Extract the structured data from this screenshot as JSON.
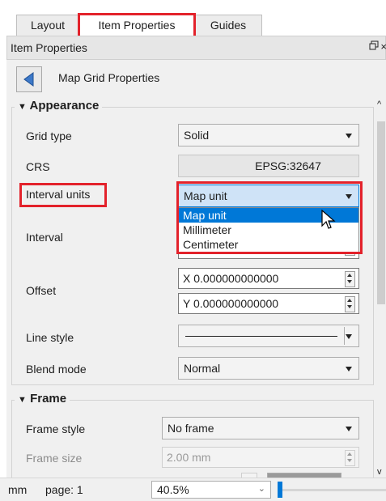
{
  "tabs": [
    {
      "label": "Layout"
    },
    {
      "label": "Item Properties"
    },
    {
      "label": "Guides"
    }
  ],
  "panel": {
    "title": "Item Properties",
    "float_icon": "float-icon",
    "close_glyph": "×"
  },
  "props_header": {
    "back_icon": "back-arrow-icon",
    "title": "Map Grid Properties"
  },
  "appearance": {
    "title": "Appearance",
    "grid_type": {
      "label": "Grid type",
      "value": "Solid"
    },
    "crs": {
      "label": "CRS",
      "value": "EPSG:32647"
    },
    "interval_units": {
      "label": "Interval units",
      "value": "Map unit",
      "options": [
        "Map unit",
        "Millimeter",
        "Centimeter"
      ]
    },
    "interval": {
      "label": "Interval"
    },
    "offset": {
      "label": "Offset",
      "x": "X 0.000000000000",
      "y": "Y 0.000000000000"
    },
    "line_style": {
      "label": "Line style"
    },
    "blend_mode": {
      "label": "Blend mode",
      "value": "Normal"
    }
  },
  "frame": {
    "title": "Frame",
    "frame_style": {
      "label": "Frame style",
      "value": "No frame"
    },
    "frame_size": {
      "label": "Frame size",
      "value": "2.00 mm"
    }
  },
  "status": {
    "units": "mm",
    "page": "page: 1",
    "zoom": "40.5%"
  },
  "colors": {
    "highlight": "#e3222b",
    "selection": "#0078d7",
    "combo_focus": "#cfe3f7"
  }
}
